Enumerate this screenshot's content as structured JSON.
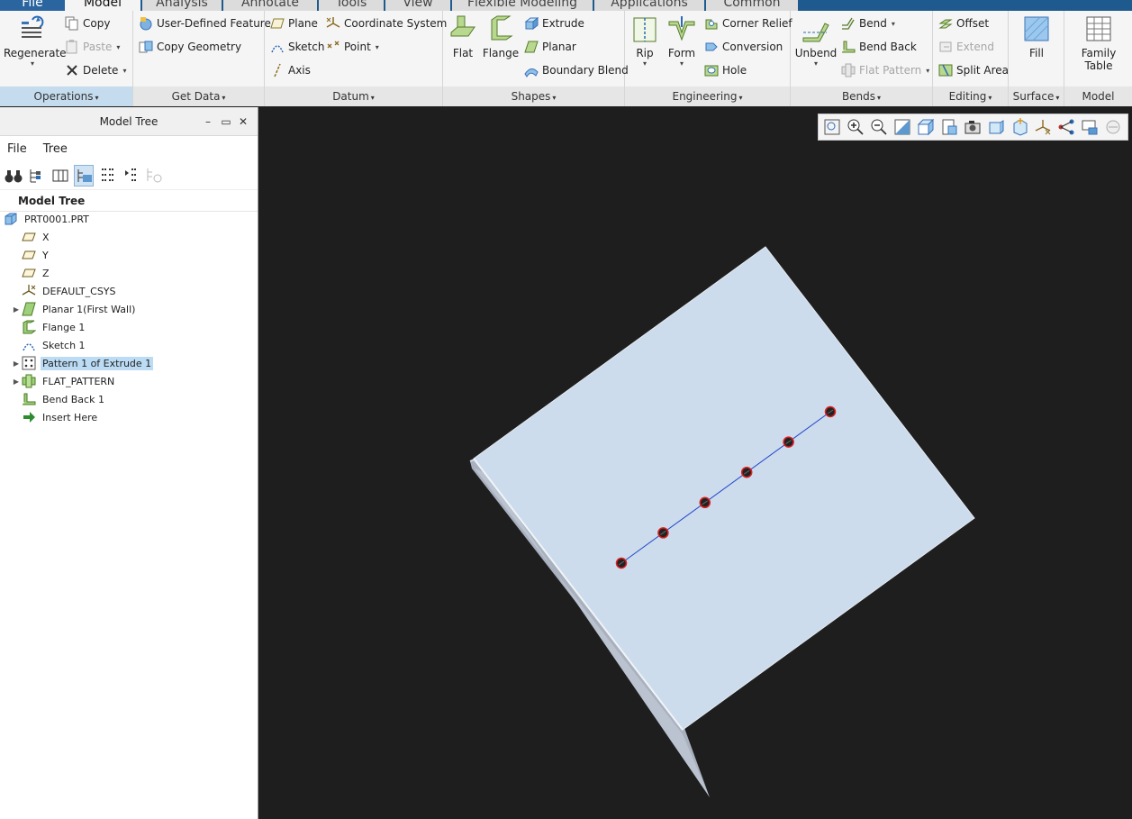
{
  "tabs": [
    "File",
    "Model",
    "Analysis",
    "Annotate",
    "Tools",
    "View",
    "Flexible Modeling",
    "Applications",
    "Common"
  ],
  "ribbon": {
    "operations": {
      "footer": "Operations",
      "regenerate": "Regenerate",
      "copy": "Copy",
      "paste": "Paste",
      "delete": "Delete"
    },
    "get_data": {
      "footer": "Get Data",
      "udf": "User-Defined Feature",
      "copy_geometry": "Copy Geometry"
    },
    "datum": {
      "footer": "Datum",
      "plane": "Plane",
      "sketch": "Sketch",
      "axis": "Axis",
      "coordinate_system": "Coordinate System",
      "point": "Point"
    },
    "shapes": {
      "footer": "Shapes",
      "flat": "Flat",
      "flange": "Flange",
      "extrude": "Extrude",
      "planar": "Planar",
      "boundary_blend": "Boundary Blend"
    },
    "engineering": {
      "footer": "Engineering",
      "rip": "Rip",
      "form": "Form",
      "corner_relief": "Corner Relief",
      "conversion": "Conversion",
      "hole": "Hole"
    },
    "bends": {
      "footer": "Bends",
      "unbend": "Unbend",
      "bend": "Bend",
      "bend_back": "Bend Back",
      "flat_pattern": "Flat Pattern"
    },
    "editing": {
      "footer": "Editing",
      "offset": "Offset",
      "extend": "Extend",
      "split_area": "Split Area"
    },
    "surface": {
      "footer": "Surface",
      "fill": "Fill"
    },
    "model_intent": {
      "footer": "Model Intent",
      "family_table_1": "Family",
      "family_table_2": "Table"
    }
  },
  "model_tree": {
    "title": "Model Tree",
    "menu": [
      "File",
      "Tree"
    ],
    "header": "Model Tree",
    "items": [
      {
        "label": "PRT0001.PRT",
        "icon": "part-icon"
      },
      {
        "label": "X",
        "icon": "datum-plane-icon"
      },
      {
        "label": "Y",
        "icon": "datum-plane-icon"
      },
      {
        "label": "Z",
        "icon": "datum-plane-icon"
      },
      {
        "label": "DEFAULT_CSYS",
        "icon": "csys-icon"
      },
      {
        "label": "Planar 1(First Wall)",
        "icon": "planar-wall-icon"
      },
      {
        "label": "Flange 1",
        "icon": "flange-icon"
      },
      {
        "label": "Sketch 1",
        "icon": "sketch-icon"
      },
      {
        "label": "Pattern 1 of Extrude 1",
        "icon": "pattern-icon"
      },
      {
        "label": "FLAT_PATTERN",
        "icon": "flat-pattern-icon"
      },
      {
        "label": "Bend Back 1",
        "icon": "bend-back-icon"
      },
      {
        "label": "Insert Here",
        "icon": "insert-arrow-icon"
      }
    ]
  },
  "viewport": {
    "background": "#1e1e1e",
    "face_color": "#ccdcec",
    "pattern_hole_count": 6
  }
}
